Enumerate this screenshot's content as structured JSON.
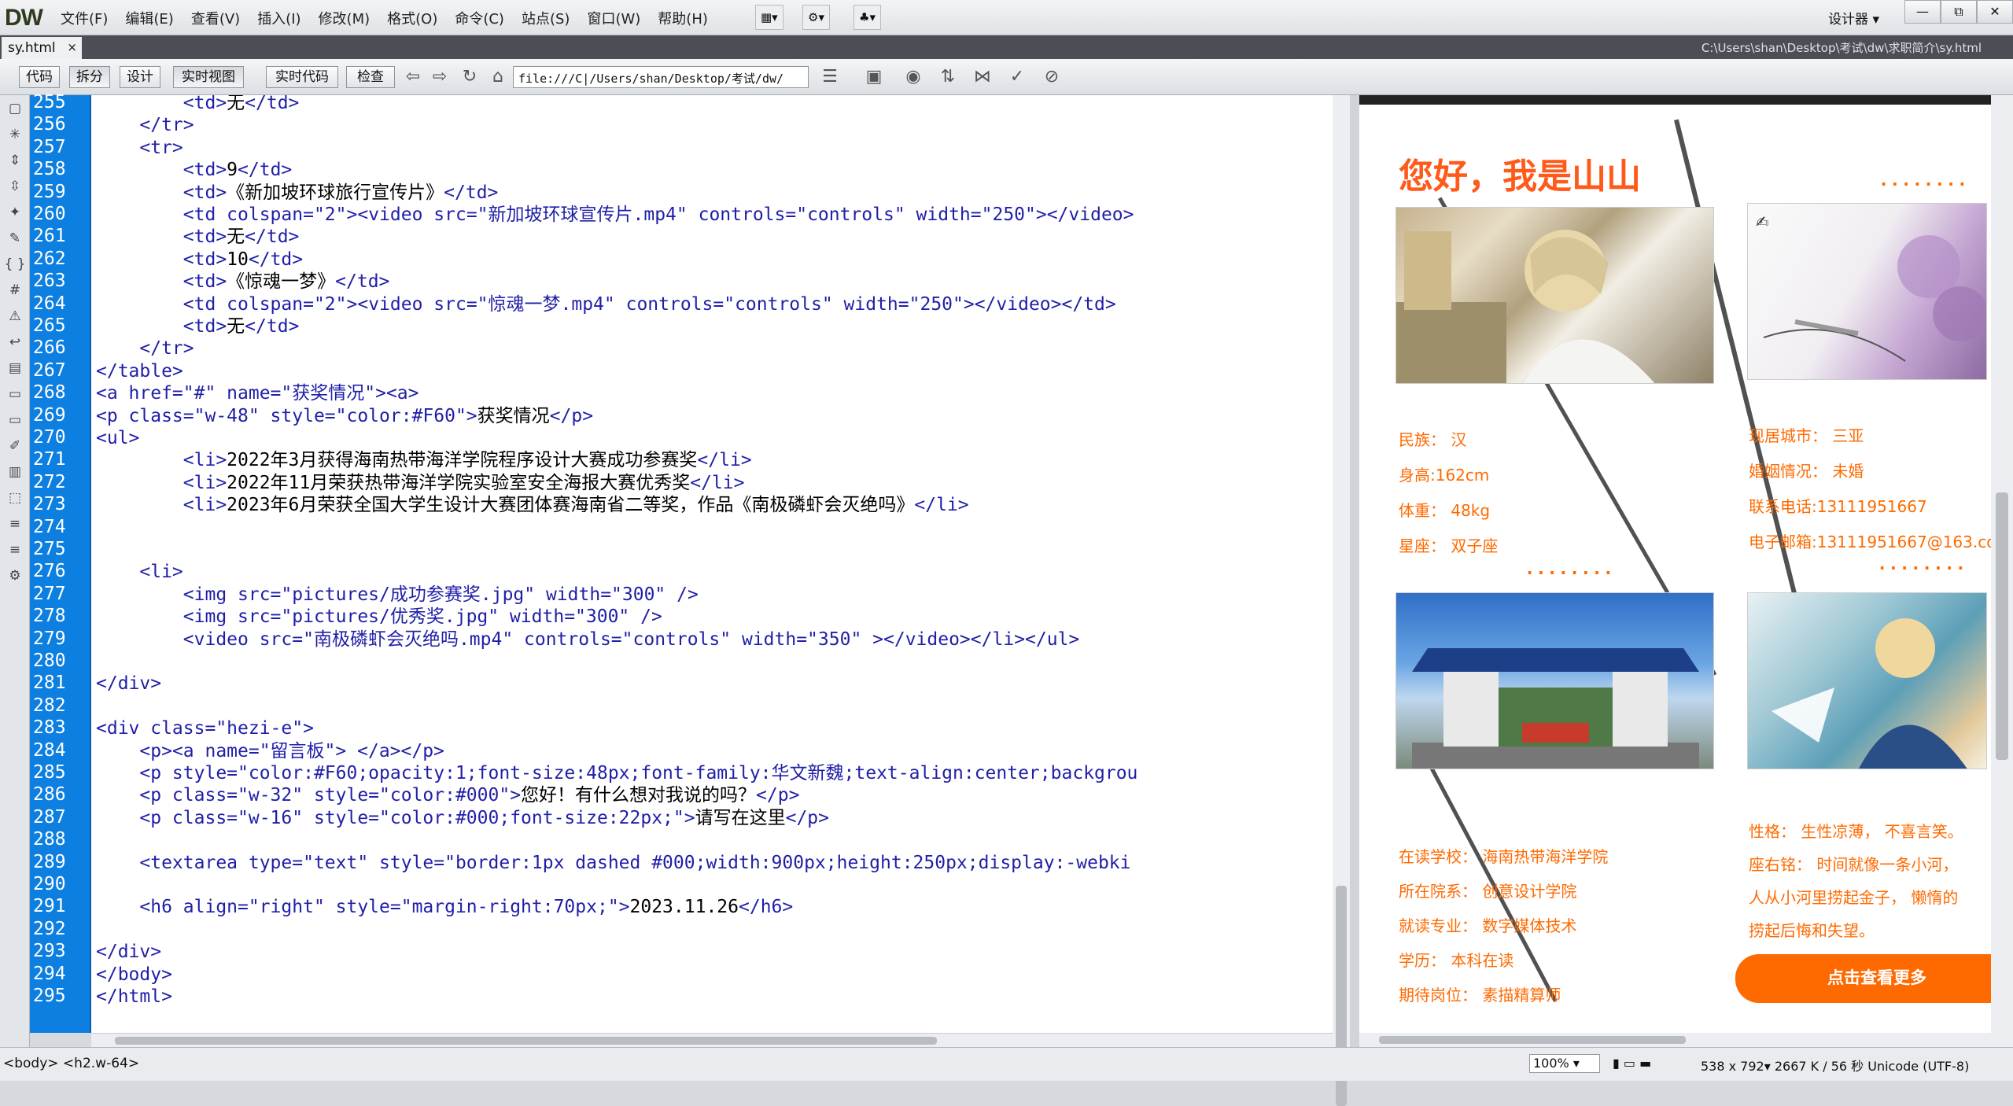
{
  "app": {
    "logo": "DW",
    "workspace": "设计器",
    "win_min": "—",
    "win_restore": "⧉",
    "win_close": "✕"
  },
  "menu": [
    "文件(F)",
    "编辑(E)",
    "查看(V)",
    "插入(I)",
    "修改(M)",
    "格式(O)",
    "命令(C)",
    "站点(S)",
    "窗口(W)",
    "帮助(H)"
  ],
  "doc_tab": {
    "name": "sy.html",
    "close": "×",
    "path": "C:\\Users\\shan\\Desktop\\考试\\dw\\求职简介\\sy.html"
  },
  "view_buttons": {
    "code": "代码",
    "split": "拆分",
    "design": "设计",
    "live": "实时视图",
    "live_code": "实时代码",
    "inspect": "检查"
  },
  "address": "file:///C|/Users/shan/Desktop/考试/dw/",
  "line_numbers": [
    "255",
    "256",
    "257",
    "258",
    "259",
    "260",
    "261",
    "262",
    "263",
    "264",
    "265",
    "266",
    "267",
    "268",
    "269",
    "270",
    "271",
    "272",
    "273",
    "274",
    "275",
    "276",
    "277",
    "278",
    "279",
    "280",
    "281",
    "282",
    "283",
    "284",
    "285",
    "286",
    "287",
    "288",
    "289",
    "290",
    "291",
    "292",
    "293",
    "294",
    "295"
  ],
  "code_lines": [
    "        <td>无</td>",
    "    </tr>",
    "    <tr>",
    "        <td>9</td>",
    "        <td>《新加坡环球旅行宣传片》</td>",
    "        <td colspan=\"2\"><video src=\"新加坡环球宣传片.mp4\" controls=\"controls\" width=\"250\"></video>",
    "        <td>无</td>",
    "        <td>10</td>",
    "        <td>《惊魂一梦》</td>",
    "        <td colspan=\"2\"><video src=\"惊魂一梦.mp4\" controls=\"controls\" width=\"250\"></video></td>",
    "        <td>无</td>",
    "    </tr>",
    "</table>",
    "<a href=\"#\" name=\"获奖情况\"><a>",
    "<p class=\"w-48\" style=\"color:#F60\">获奖情况</p>",
    "<ul>",
    "        <li>2022年3月获得海南热带海洋学院程序设计大赛成功参赛奖</li>",
    "        <li>2022年11月荣获热带海洋学院实验室安全海报大赛优秀奖</li>",
    "        <li>2023年6月荣获全国大学生设计大赛团体赛海南省二等奖，作品《南极磷虾会灭绝吗》</li>",
    "",
    "",
    "    <li>",
    "        <img src=\"pictures/成功参赛奖.jpg\" width=\"300\" />",
    "        <img src=\"pictures/优秀奖.jpg\" width=\"300\" />",
    "        <video src=\"南极磷虾会灭绝吗.mp4\" controls=\"controls\" width=\"350\" ></video></li></ul>",
    "",
    "</div>",
    "",
    "<div class=\"hezi-e\">",
    "    <p><a name=\"留言板\"> </a></p>",
    "    <p style=\"color:#F60;opacity:1;font-size:48px;font-family:华文新魏;text-align:center;backgrou",
    "    <p class=\"w-32\" style=\"color:#000\">您好！有什么想对我说的吗？</p>",
    "    <p class=\"w-16\" style=\"color:#000;font-size:22px;\">请写在这里</p>",
    "",
    "    <textarea type=\"text\" style=\"border:1px dashed #000;width:900px;height:250px;display:-webki",
    "",
    "    <h6 align=\"right\" style=\"margin-right:70px;\">2023.11.26</h6>",
    "",
    "</div>",
    "</body>",
    "</html>"
  ],
  "live": {
    "title": "您好，我是山山",
    "dots": "........",
    "left_info": [
      "民族： 汉",
      "身高:162cm",
      "体重： 48kg",
      "星座： 双子座"
    ],
    "right_info": [
      "现居城市： 三亚",
      "婚姻情况： 未婚",
      "联系电话:13111951667",
      "电子邮箱:13111951667@163.co"
    ],
    "school_info": [
      "在读学校： 海南热带海洋学院",
      "所在院系： 创意设计学院",
      "就读专业： 数字媒体技术",
      "学历： 本科在读",
      "期待岗位： 素描精算师"
    ],
    "motto": [
      "性格： 生性凉薄， 不喜言笑。",
      "座右铭： 时间就像一条小河，",
      "人从小河里捞起金子， 懒惰的",
      "捞起后悔和失望。"
    ],
    "more_button": "点击查看更多",
    "colors": {
      "accent": "#ff6a00",
      "gutter": "#0d7fe0"
    }
  },
  "status": {
    "tag_selector": "<body> <h2.w-64>",
    "zoom": "100%",
    "info": "538 x 792▾  2667 K / 56 秒  Unicode (UTF-8)"
  }
}
